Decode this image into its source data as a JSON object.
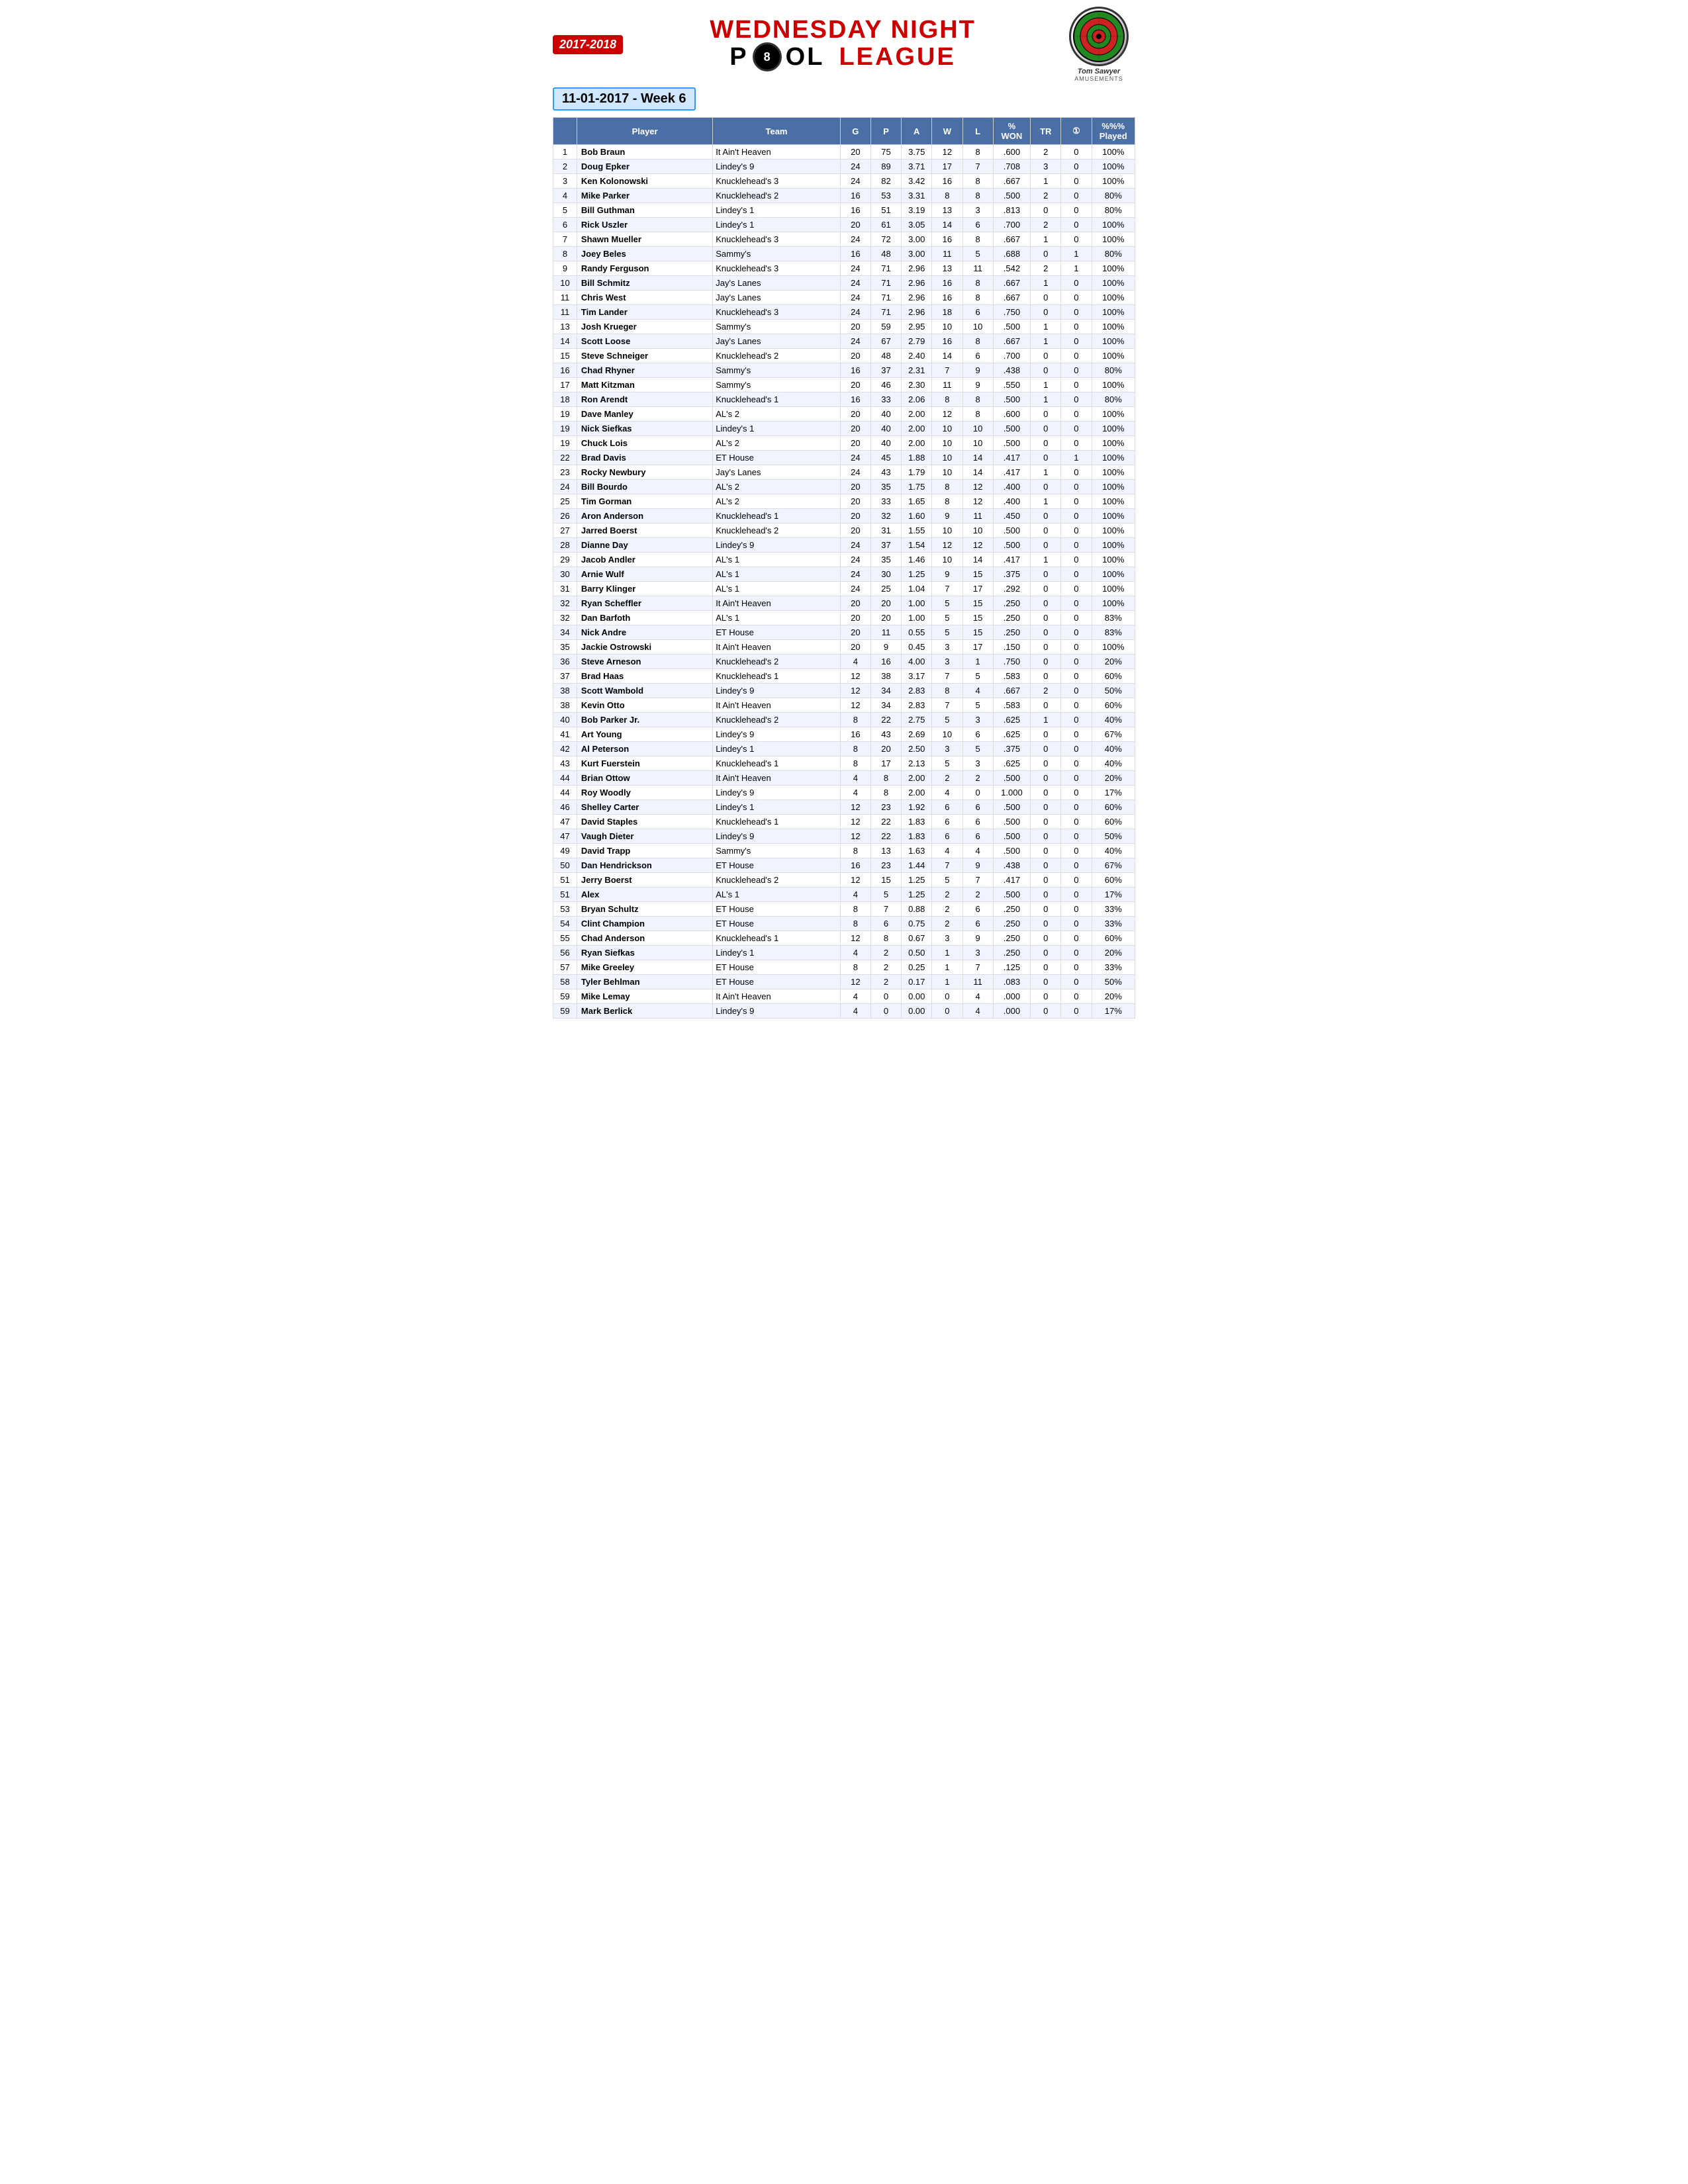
{
  "header": {
    "year": "2017-2018",
    "title_line1": "WEDNESDAY NIGHT",
    "title_line2": "POOL  LEAGUE",
    "pool_ball": "8",
    "date": "11-01-2017 - Week 6",
    "logo_name": "Tom Sawyer",
    "logo_sub": "AMUSEMENTS"
  },
  "table": {
    "columns": [
      "",
      "Player",
      "Team",
      "G",
      "P",
      "A",
      "W",
      "L",
      "% WON",
      "TR",
      "6-ball",
      "%%% Played"
    ],
    "rows": [
      [
        "1",
        "Bob Braun",
        "It Ain't Heaven",
        "20",
        "75",
        "3.75",
        "12",
        "8",
        ".600",
        "2",
        "0",
        "100%"
      ],
      [
        "2",
        "Doug Epker",
        "Lindey's 9",
        "24",
        "89",
        "3.71",
        "17",
        "7",
        ".708",
        "3",
        "0",
        "100%"
      ],
      [
        "3",
        "Ken Kolonowski",
        "Knucklehead's 3",
        "24",
        "82",
        "3.42",
        "16",
        "8",
        ".667",
        "1",
        "0",
        "100%"
      ],
      [
        "4",
        "Mike Parker",
        "Knucklehead's 2",
        "16",
        "53",
        "3.31",
        "8",
        "8",
        ".500",
        "2",
        "0",
        "80%"
      ],
      [
        "5",
        "Bill Guthman",
        "Lindey's 1",
        "16",
        "51",
        "3.19",
        "13",
        "3",
        ".813",
        "0",
        "0",
        "80%"
      ],
      [
        "6",
        "Rick Uszler",
        "Lindey's 1",
        "20",
        "61",
        "3.05",
        "14",
        "6",
        ".700",
        "2",
        "0",
        "100%"
      ],
      [
        "7",
        "Shawn Mueller",
        "Knucklehead's 3",
        "24",
        "72",
        "3.00",
        "16",
        "8",
        ".667",
        "1",
        "0",
        "100%"
      ],
      [
        "8",
        "Joey Beles",
        "Sammy's",
        "16",
        "48",
        "3.00",
        "11",
        "5",
        ".688",
        "0",
        "1",
        "80%"
      ],
      [
        "9",
        "Randy Ferguson",
        "Knucklehead's 3",
        "24",
        "71",
        "2.96",
        "13",
        "11",
        ".542",
        "2",
        "1",
        "100%"
      ],
      [
        "10",
        "Bill Schmitz",
        "Jay's Lanes",
        "24",
        "71",
        "2.96",
        "16",
        "8",
        ".667",
        "1",
        "0",
        "100%"
      ],
      [
        "11",
        "Chris West",
        "Jay's Lanes",
        "24",
        "71",
        "2.96",
        "16",
        "8",
        ".667",
        "0",
        "0",
        "100%"
      ],
      [
        "11",
        "Tim Lander",
        "Knucklehead's 3",
        "24",
        "71",
        "2.96",
        "18",
        "6",
        ".750",
        "0",
        "0",
        "100%"
      ],
      [
        "13",
        "Josh Krueger",
        "Sammy's",
        "20",
        "59",
        "2.95",
        "10",
        "10",
        ".500",
        "1",
        "0",
        "100%"
      ],
      [
        "14",
        "Scott Loose",
        "Jay's Lanes",
        "24",
        "67",
        "2.79",
        "16",
        "8",
        ".667",
        "1",
        "0",
        "100%"
      ],
      [
        "15",
        "Steve Schneiger",
        "Knucklehead's 2",
        "20",
        "48",
        "2.40",
        "14",
        "6",
        ".700",
        "0",
        "0",
        "100%"
      ],
      [
        "16",
        "Chad Rhyner",
        "Sammy's",
        "16",
        "37",
        "2.31",
        "7",
        "9",
        ".438",
        "0",
        "0",
        "80%"
      ],
      [
        "17",
        "Matt Kitzman",
        "Sammy's",
        "20",
        "46",
        "2.30",
        "11",
        "9",
        ".550",
        "1",
        "0",
        "100%"
      ],
      [
        "18",
        "Ron Arendt",
        "Knucklehead's 1",
        "16",
        "33",
        "2.06",
        "8",
        "8",
        ".500",
        "1",
        "0",
        "80%"
      ],
      [
        "19",
        "Dave Manley",
        "AL's 2",
        "20",
        "40",
        "2.00",
        "12",
        "8",
        ".600",
        "0",
        "0",
        "100%"
      ],
      [
        "19",
        "Nick Siefkas",
        "Lindey's 1",
        "20",
        "40",
        "2.00",
        "10",
        "10",
        ".500",
        "0",
        "0",
        "100%"
      ],
      [
        "19",
        "Chuck Lois",
        "AL's 2",
        "20",
        "40",
        "2.00",
        "10",
        "10",
        ".500",
        "0",
        "0",
        "100%"
      ],
      [
        "22",
        "Brad Davis",
        "ET House",
        "24",
        "45",
        "1.88",
        "10",
        "14",
        ".417",
        "0",
        "1",
        "100%"
      ],
      [
        "23",
        "Rocky Newbury",
        "Jay's Lanes",
        "24",
        "43",
        "1.79",
        "10",
        "14",
        ".417",
        "1",
        "0",
        "100%"
      ],
      [
        "24",
        "Bill Bourdo",
        "AL's 2",
        "20",
        "35",
        "1.75",
        "8",
        "12",
        ".400",
        "0",
        "0",
        "100%"
      ],
      [
        "25",
        "Tim Gorman",
        "AL's 2",
        "20",
        "33",
        "1.65",
        "8",
        "12",
        ".400",
        "1",
        "0",
        "100%"
      ],
      [
        "26",
        "Aron Anderson",
        "Knucklehead's 1",
        "20",
        "32",
        "1.60",
        "9",
        "11",
        ".450",
        "0",
        "0",
        "100%"
      ],
      [
        "27",
        "Jarred Boerst",
        "Knucklehead's 2",
        "20",
        "31",
        "1.55",
        "10",
        "10",
        ".500",
        "0",
        "0",
        "100%"
      ],
      [
        "28",
        "Dianne Day",
        "Lindey's 9",
        "24",
        "37",
        "1.54",
        "12",
        "12",
        ".500",
        "0",
        "0",
        "100%"
      ],
      [
        "29",
        "Jacob Andler",
        "AL's 1",
        "24",
        "35",
        "1.46",
        "10",
        "14",
        ".417",
        "1",
        "0",
        "100%"
      ],
      [
        "30",
        "Arnie Wulf",
        "AL's 1",
        "24",
        "30",
        "1.25",
        "9",
        "15",
        ".375",
        "0",
        "0",
        "100%"
      ],
      [
        "31",
        "Barry Klinger",
        "AL's 1",
        "24",
        "25",
        "1.04",
        "7",
        "17",
        ".292",
        "0",
        "0",
        "100%"
      ],
      [
        "32",
        "Ryan Scheffler",
        "It Ain't Heaven",
        "20",
        "20",
        "1.00",
        "5",
        "15",
        ".250",
        "0",
        "0",
        "100%"
      ],
      [
        "32",
        "Dan Barfoth",
        "AL's 1",
        "20",
        "20",
        "1.00",
        "5",
        "15",
        ".250",
        "0",
        "0",
        "83%"
      ],
      [
        "34",
        "Nick Andre",
        "ET House",
        "20",
        "11",
        "0.55",
        "5",
        "15",
        ".250",
        "0",
        "0",
        "83%"
      ],
      [
        "35",
        "Jackie Ostrowski",
        "It Ain't Heaven",
        "20",
        "9",
        "0.45",
        "3",
        "17",
        ".150",
        "0",
        "0",
        "100%"
      ],
      [
        "36",
        "Steve Arneson",
        "Knucklehead's 2",
        "4",
        "16",
        "4.00",
        "3",
        "1",
        ".750",
        "0",
        "0",
        "20%"
      ],
      [
        "37",
        "Brad Haas",
        "Knucklehead's 1",
        "12",
        "38",
        "3.17",
        "7",
        "5",
        ".583",
        "0",
        "0",
        "60%"
      ],
      [
        "38",
        "Scott Wambold",
        "Lindey's 9",
        "12",
        "34",
        "2.83",
        "8",
        "4",
        ".667",
        "2",
        "0",
        "50%"
      ],
      [
        "38",
        "Kevin Otto",
        "It Ain't Heaven",
        "12",
        "34",
        "2.83",
        "7",
        "5",
        ".583",
        "0",
        "0",
        "60%"
      ],
      [
        "40",
        "Bob Parker Jr.",
        "Knucklehead's 2",
        "8",
        "22",
        "2.75",
        "5",
        "3",
        ".625",
        "1",
        "0",
        "40%"
      ],
      [
        "41",
        "Art Young",
        "Lindey's 9",
        "16",
        "43",
        "2.69",
        "10",
        "6",
        ".625",
        "0",
        "0",
        "67%"
      ],
      [
        "42",
        "Al Peterson",
        "Lindey's 1",
        "8",
        "20",
        "2.50",
        "3",
        "5",
        ".375",
        "0",
        "0",
        "40%"
      ],
      [
        "43",
        "Kurt Fuerstein",
        "Knucklehead's 1",
        "8",
        "17",
        "2.13",
        "5",
        "3",
        ".625",
        "0",
        "0",
        "40%"
      ],
      [
        "44",
        "Brian Ottow",
        "It Ain't Heaven",
        "4",
        "8",
        "2.00",
        "2",
        "2",
        ".500",
        "0",
        "0",
        "20%"
      ],
      [
        "44",
        "Roy Woodly",
        "Lindey's 9",
        "4",
        "8",
        "2.00",
        "4",
        "0",
        "1.000",
        "0",
        "0",
        "17%"
      ],
      [
        "46",
        "Shelley Carter",
        "Lindey's 1",
        "12",
        "23",
        "1.92",
        "6",
        "6",
        ".500",
        "0",
        "0",
        "60%"
      ],
      [
        "47",
        "David Staples",
        "Knucklehead's 1",
        "12",
        "22",
        "1.83",
        "6",
        "6",
        ".500",
        "0",
        "0",
        "60%"
      ],
      [
        "47",
        "Vaugh Dieter",
        "Lindey's 9",
        "12",
        "22",
        "1.83",
        "6",
        "6",
        ".500",
        "0",
        "0",
        "50%"
      ],
      [
        "49",
        "David Trapp",
        "Sammy's",
        "8",
        "13",
        "1.63",
        "4",
        "4",
        ".500",
        "0",
        "0",
        "40%"
      ],
      [
        "50",
        "Dan Hendrickson",
        "ET House",
        "16",
        "23",
        "1.44",
        "7",
        "9",
        ".438",
        "0",
        "0",
        "67%"
      ],
      [
        "51",
        "Jerry Boerst",
        "Knucklehead's 2",
        "12",
        "15",
        "1.25",
        "5",
        "7",
        ".417",
        "0",
        "0",
        "60%"
      ],
      [
        "51",
        "Alex",
        "AL's 1",
        "4",
        "5",
        "1.25",
        "2",
        "2",
        ".500",
        "0",
        "0",
        "17%"
      ],
      [
        "53",
        "Bryan Schultz",
        "ET House",
        "8",
        "7",
        "0.88",
        "2",
        "6",
        ".250",
        "0",
        "0",
        "33%"
      ],
      [
        "54",
        "Clint Champion",
        "ET House",
        "8",
        "6",
        "0.75",
        "2",
        "6",
        ".250",
        "0",
        "0",
        "33%"
      ],
      [
        "55",
        "Chad Anderson",
        "Knucklehead's 1",
        "12",
        "8",
        "0.67",
        "3",
        "9",
        ".250",
        "0",
        "0",
        "60%"
      ],
      [
        "56",
        "Ryan Siefkas",
        "Lindey's 1",
        "4",
        "2",
        "0.50",
        "1",
        "3",
        ".250",
        "0",
        "0",
        "20%"
      ],
      [
        "57",
        "Mike Greeley",
        "ET House",
        "8",
        "2",
        "0.25",
        "1",
        "7",
        ".125",
        "0",
        "0",
        "33%"
      ],
      [
        "58",
        "Tyler Behlman",
        "ET House",
        "12",
        "2",
        "0.17",
        "1",
        "11",
        ".083",
        "0",
        "0",
        "50%"
      ],
      [
        "59",
        "Mike Lemay",
        "It Ain't Heaven",
        "4",
        "0",
        "0.00",
        "0",
        "4",
        ".000",
        "0",
        "0",
        "20%"
      ],
      [
        "59",
        "Mark Berlick",
        "Lindey's 9",
        "4",
        "0",
        "0.00",
        "0",
        "4",
        ".000",
        "0",
        "0",
        "17%"
      ]
    ]
  }
}
